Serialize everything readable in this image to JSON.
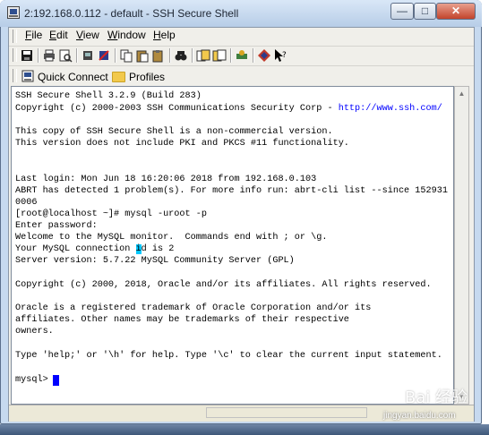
{
  "window": {
    "title": "2:192.168.0.112 - default - SSH Secure Shell",
    "minimize": "—",
    "maximize": "□",
    "close": "✕"
  },
  "menu": {
    "file": "File",
    "edit": "Edit",
    "view": "View",
    "window": "Window",
    "help": "Help"
  },
  "toolbar": {
    "icons": [
      "save-icon",
      "print-icon",
      "print-preview-icon",
      "connect-icon",
      "disconnect-icon",
      "copy-icon",
      "paste-icon",
      "paste-alt-icon",
      "find-icon",
      "file-transfer-icon",
      "new-terminal-icon",
      "settings-icon",
      "profile-icon",
      "context-help-icon"
    ]
  },
  "quickbar": {
    "quick_connect": "Quick Connect",
    "profiles": "Profiles"
  },
  "terminal": {
    "line1": "SSH Secure Shell 3.2.9 (Build 283)",
    "line2_prefix": "Copyright (c) 2000-2003 SSH Communications Security Corp - ",
    "line2_link": "http://www.ssh.com/",
    "line3": "This copy of SSH Secure Shell is a non-commercial version.",
    "line4": "This version does not include PKI and PKCS #11 functionality.",
    "line5": "Last login: Mon Jun 18 16:20:06 2018 from 192.168.0.103",
    "line6": "ABRT has detected 1 problem(s). For more info run: abrt-cli list --since 152931",
    "line7": "0006",
    "line8": "[root@localhost ~]# mysql -uroot -p",
    "line9": "Enter password:",
    "line10": "Welcome to the MySQL monitor.  Commands end with ; or \\g.",
    "line11_a": "Your MySQL connection ",
    "line11_hl": "i",
    "line11_b": "d is 2",
    "line12": "Server version: 5.7.22 MySQL Community Server (GPL)",
    "line13": "Copyright (c) 2000, 2018, Oracle and/or its affiliates. All rights reserved.",
    "line14": "Oracle is a registered trademark of Oracle Corporation and/or its",
    "line15": "affiliates. Other names may be trademarks of their respective",
    "line16": "owners.",
    "line17": "Type 'help;' or '\\h' for help. Type '\\c' to clear the current input statement.",
    "prompt": "mysql> "
  },
  "watermark": {
    "logo": "Bai 经验",
    "url": "jingyan.baidu.com"
  },
  "colors": {
    "link": "#0000ff",
    "cursor": "#0000ff",
    "highlight": "#00c8ff"
  }
}
